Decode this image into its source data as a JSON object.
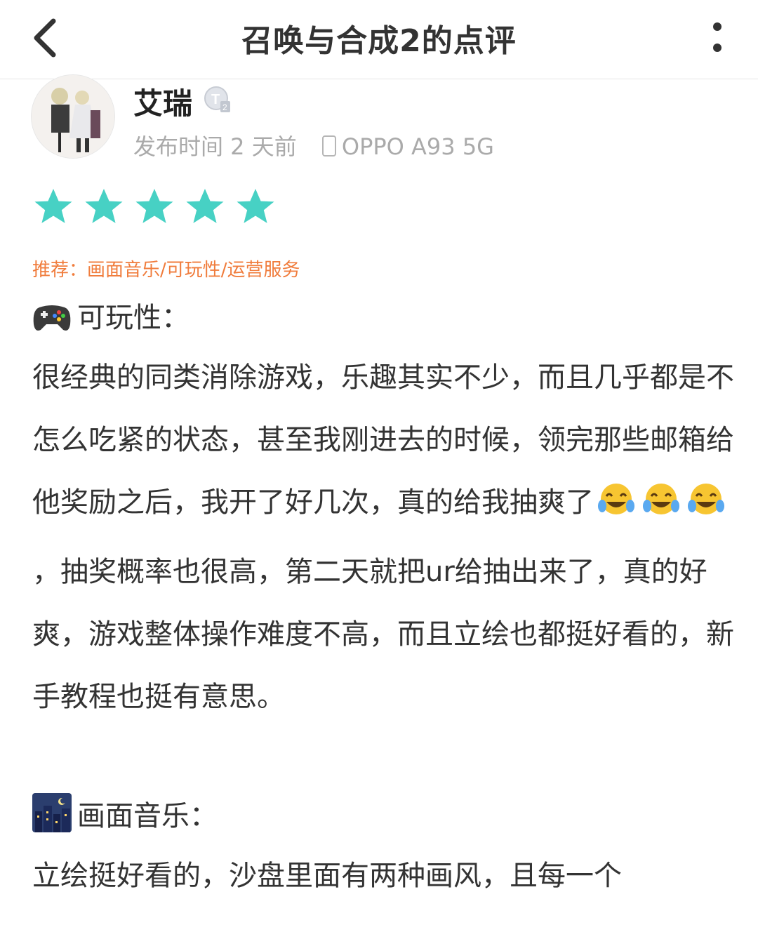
{
  "header": {
    "title": "召唤与合成2的点评"
  },
  "author": {
    "name": "艾瑞",
    "badge_text": "T2"
  },
  "meta": {
    "publish_label": "发布时间 2 天前",
    "device": "OPPO A93 5G"
  },
  "rating": {
    "stars": 5,
    "max": 5,
    "color": "#47d1c4"
  },
  "recommend": {
    "text": "推荐：画面音乐/可玩性/运营服务"
  },
  "sections": [
    {
      "heading": "可玩性：",
      "icon": "gamepad-icon",
      "p1_before_emoji": "很经典的同类消除游戏，乐趣其实不少，而且几乎都是不怎么吃紧的状态，甚至我刚进去的时候，领完那些邮箱给他奖励之后，我开了好几次，真的给我抽爽了",
      "emoji": "tears-of-joy-icon",
      "p1_after_emoji": "，抽奖概率也很高，第二天就把ur给抽出来了，真的好爽，游戏整体操作难度不高，而且立绘也都挺好看的，新手教程也挺有意思。"
    },
    {
      "heading": "画面音乐：",
      "icon": "night-city-icon",
      "p1": "立绘挺好看的，沙盘里面有两种画风，且每一个"
    }
  ]
}
